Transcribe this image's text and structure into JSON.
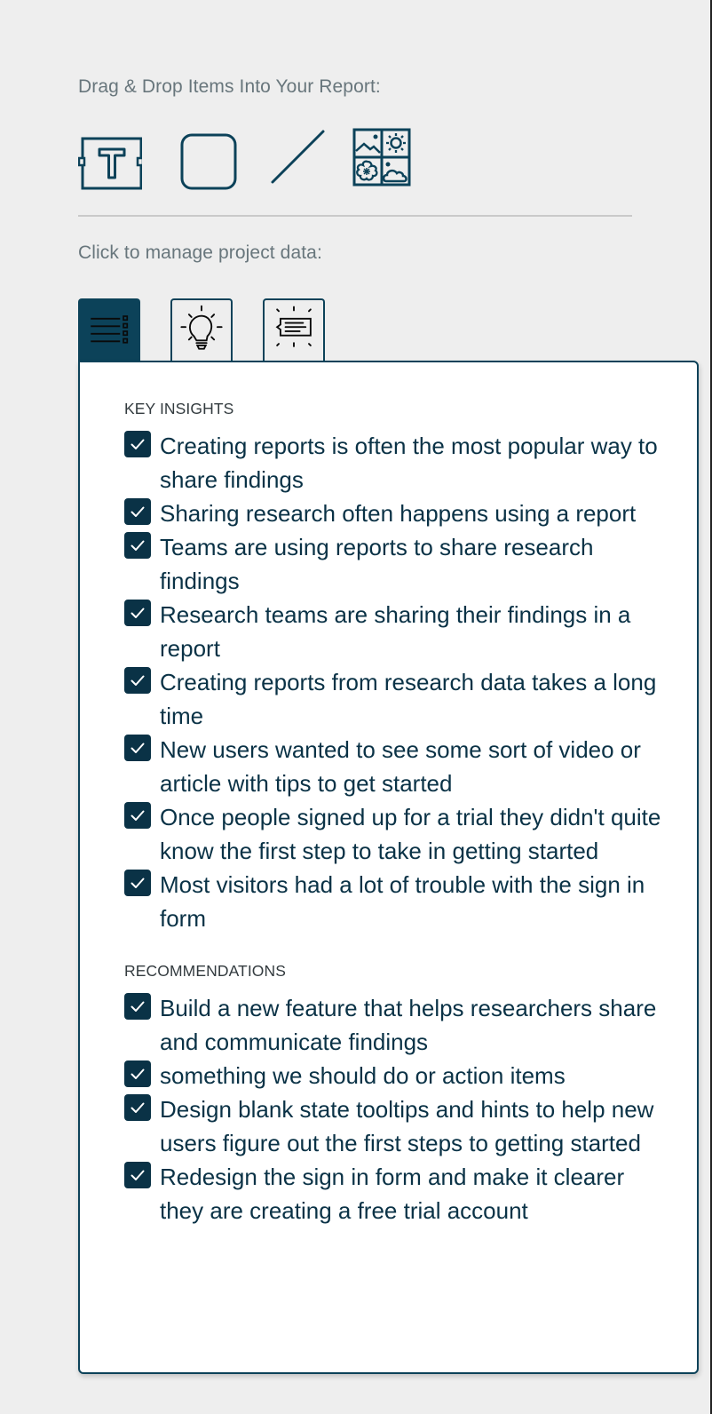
{
  "drag_section": {
    "label": "Drag & Drop Items Into Your Report:",
    "tools": [
      {
        "name": "text-box-tool",
        "icon": "text-box-icon"
      },
      {
        "name": "rectangle-tool",
        "icon": "rounded-square-icon"
      },
      {
        "name": "line-tool",
        "icon": "diagonal-line-icon"
      },
      {
        "name": "image-tool",
        "icon": "image-grid-icon"
      }
    ]
  },
  "manage_section": {
    "label": "Click to manage project data:",
    "tabs": [
      {
        "name": "tab-list",
        "icon": "list-icon",
        "active": true
      },
      {
        "name": "tab-insights",
        "icon": "lightbulb-icon",
        "active": false
      },
      {
        "name": "tab-recommendations",
        "icon": "highlight-note-icon",
        "active": false
      }
    ]
  },
  "panel": {
    "key_insights": {
      "title": "KEY INSIGHTS",
      "items": [
        {
          "text": "Creating reports is often the most popular way to share findings",
          "checked": true
        },
        {
          "text": "Sharing research often happens using a report",
          "checked": true
        },
        {
          "text": "Teams are using reports to share research findings",
          "checked": true
        },
        {
          "text": "Research teams are sharing their findings in a report",
          "checked": true
        },
        {
          "text": "Creating reports from research data takes a long time",
          "checked": true
        },
        {
          "text": "New users wanted to see some sort of video or article with tips to get started",
          "checked": true
        },
        {
          "text": "Once people signed up for a trial they didn't quite know the first step to take in getting started",
          "checked": true
        },
        {
          "text": "Most visitors had a lot of trouble with the sign in form",
          "checked": true
        }
      ]
    },
    "recommendations": {
      "title": "RECOMMENDATIONS",
      "items": [
        {
          "text": "Build a new feature that helps researchers share and communicate findings",
          "checked": true
        },
        {
          "text": "something we should do or action items",
          "checked": true
        },
        {
          "text": "Design blank state tooltips and hints to help new users figure out the first steps to getting started",
          "checked": true
        },
        {
          "text": "Redesign the sign in form and make it clearer they are creating a free trial account",
          "checked": true
        }
      ]
    }
  },
  "colors": {
    "primary": "#0c4259",
    "checkbox": "#0a3246",
    "background": "#eeeeee",
    "label": "#68767c"
  }
}
